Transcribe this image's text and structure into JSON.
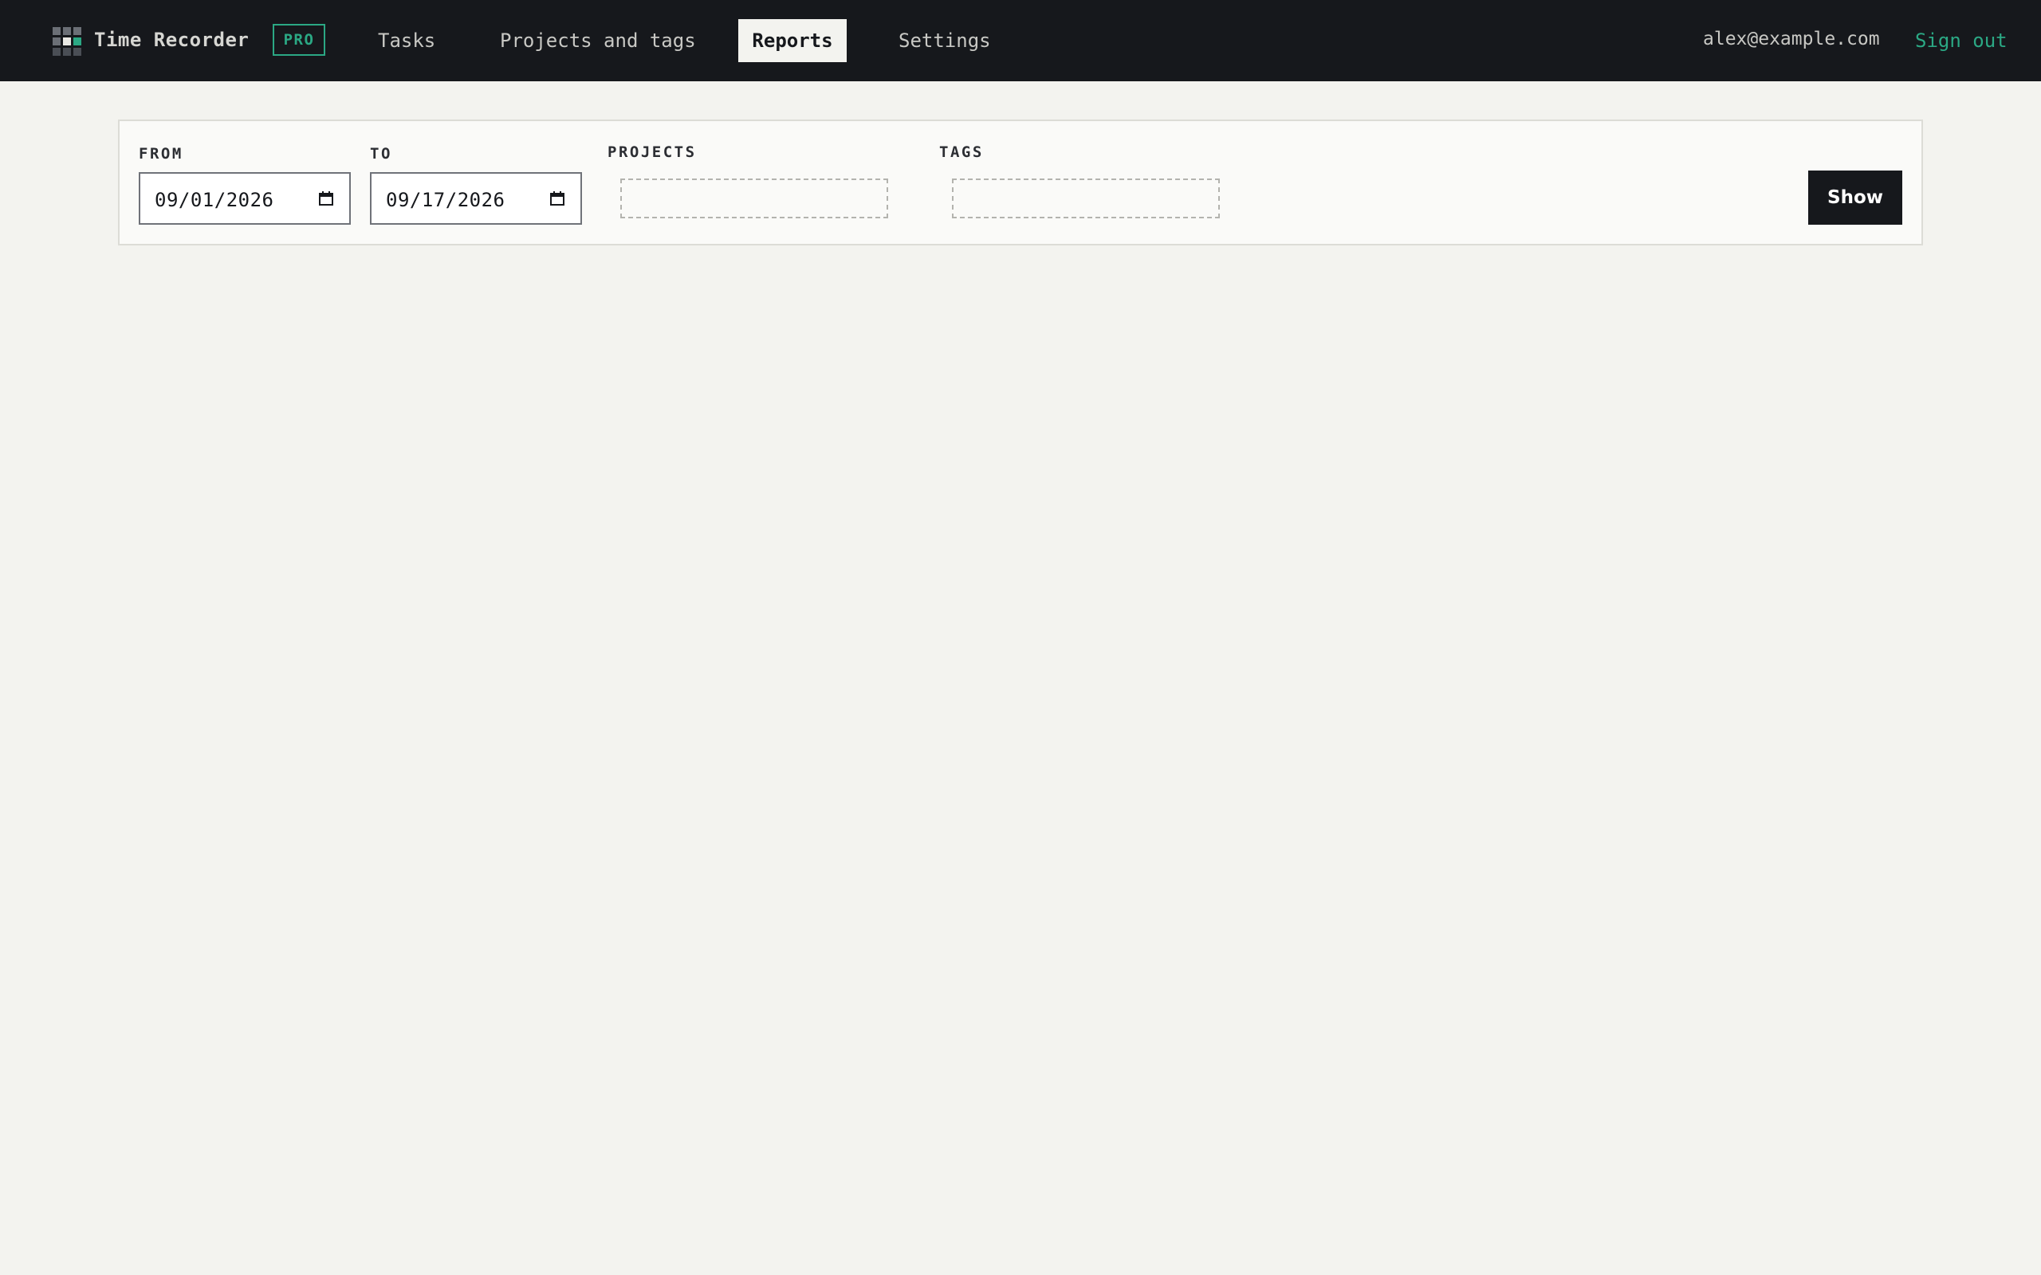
{
  "app": {
    "title": "Time Recorder",
    "badge": "PRO",
    "logo_icon": "grid-logo-icon"
  },
  "nav": {
    "tabs": [
      {
        "label": "Tasks",
        "active": false
      },
      {
        "label": "Projects and tags",
        "active": false
      },
      {
        "label": "Reports",
        "active": true
      },
      {
        "label": "Settings",
        "active": false
      }
    ]
  },
  "user": {
    "email": "alex@example.com",
    "sign_out_label": "Sign out"
  },
  "filters": {
    "from": {
      "label": "FROM",
      "value": "09/01/2026",
      "icon": "calendar-icon"
    },
    "to": {
      "label": "TO",
      "value": "09/17/2026",
      "icon": "calendar-icon"
    },
    "projects": {
      "label": "PROJECTS",
      "selected": []
    },
    "tags": {
      "label": "TAGS",
      "selected": []
    },
    "show_label": "Show"
  },
  "colors": {
    "topbar_bg": "#16181c",
    "page_bg": "#f3f3ef",
    "accent": "#2ba884",
    "panel_bg": "#fafaf8"
  }
}
